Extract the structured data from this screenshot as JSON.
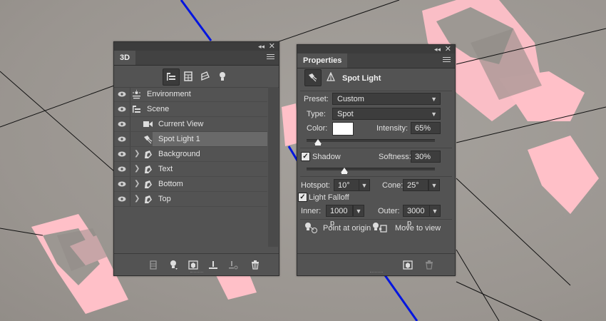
{
  "panel_3d": {
    "tab_label": "3D",
    "filter_icons": [
      "scene-filter-icon",
      "mesh-filter-icon",
      "material-filter-icon",
      "light-filter-icon"
    ],
    "layers": [
      {
        "label": "Environment",
        "icon": "environment-icon",
        "visible": true
      },
      {
        "label": "Scene",
        "icon": "scene-icon",
        "visible": true
      },
      {
        "label": "Current View",
        "icon": "camera-icon",
        "visible": true
      },
      {
        "label": "Spot Light 1",
        "icon": "spot-light-icon",
        "visible": true,
        "selected": true
      },
      {
        "label": "Background",
        "icon": "mesh-icon",
        "visible": true,
        "expandable": true
      },
      {
        "label": "Text",
        "icon": "mesh-icon",
        "visible": true,
        "expandable": true
      },
      {
        "label": "Bottom",
        "icon": "mesh-icon",
        "visible": true,
        "expandable": true
      },
      {
        "label": "Top",
        "icon": "mesh-icon",
        "visible": true,
        "expandable": true
      }
    ],
    "bottom_icons": [
      "render-icon",
      "add-light-icon",
      "add-mesh-icon",
      "ground-icon",
      "light-to-origin-icon",
      "trash-icon"
    ]
  },
  "properties": {
    "tab_label": "Properties",
    "header_title": "Spot Light",
    "preset_label": "Preset:",
    "preset_value": "Custom",
    "type_label": "Type:",
    "type_value": "Spot",
    "color_label": "Color:",
    "color_value": "#ffffff",
    "intensity_label": "Intensity:",
    "intensity_value": "65%",
    "intensity_fraction": 0.65,
    "shadow_label": "Shadow",
    "shadow_checked": true,
    "softness_label": "Softness:",
    "softness_value": "30%",
    "softness_fraction": 0.3,
    "hotspot_label": "Hotspot:",
    "hotspot_value": "10°",
    "cone_label": "Cone:",
    "cone_value": "25°",
    "falloff_label": "Light Falloff",
    "falloff_checked": true,
    "inner_label": "Inner:",
    "inner_value": "1000 p",
    "outer_label": "Outer:",
    "outer_value": "3000 p",
    "point_origin_label": "Point at origin",
    "move_view_label": "Move to view"
  },
  "colors": {
    "panel_bg": "#535353",
    "canvas_bg": "#9f9a95",
    "accent_pink": "#ffc0c8",
    "axis_blue": "#0015e0"
  }
}
